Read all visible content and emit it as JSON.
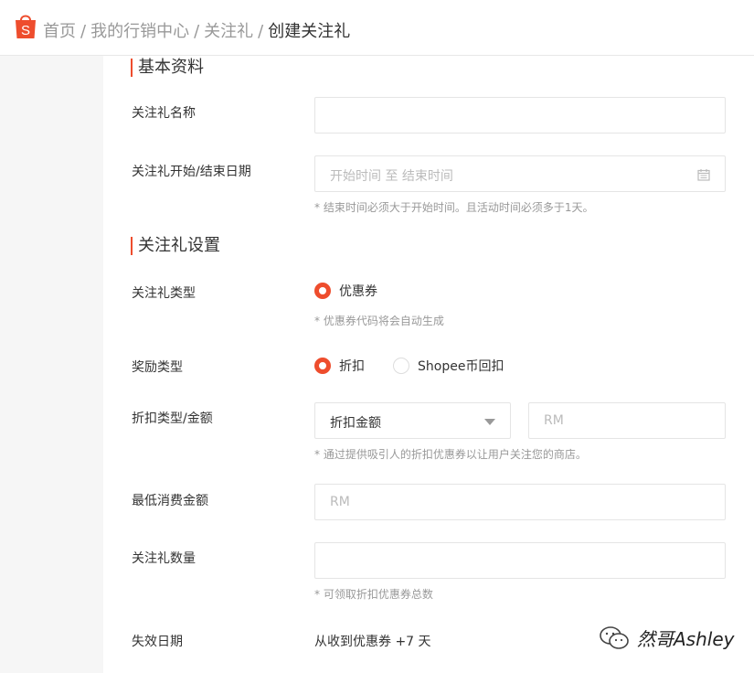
{
  "breadcrumb": {
    "items": [
      "首页",
      "我的行销中心",
      "关注礼"
    ],
    "separator": "/",
    "current": "创建关注礼"
  },
  "logo": {
    "letter": "S",
    "color": "#ee4d2d"
  },
  "sections": {
    "basic": {
      "title": "基本资料",
      "name_label": "关注礼名称",
      "name_value": "",
      "date_label": "关注礼开始/结束日期",
      "date_start_placeholder": "开始时间",
      "date_to": "至",
      "date_end_placeholder": "结束时间",
      "date_hint": "* 结束时间必须大于开始时间。且活动时间必须多于1天。"
    },
    "settings": {
      "title": "关注礼设置",
      "type_label": "关注礼类型",
      "type_option": "优惠券",
      "type_hint": "* 优惠券代码将会自动生成",
      "reward_label": "奖励类型",
      "reward_options": [
        {
          "label": "折扣",
          "selected": true
        },
        {
          "label": "Shopee币回扣",
          "selected": false
        }
      ],
      "discount_label": "折扣类型/金额",
      "discount_type_value": "折扣金额",
      "discount_amount_placeholder": "RM",
      "discount_hint": "* 通过提供吸引人的折扣优惠券以让用户关注您的商店。",
      "min_spend_label": "最低消费金额",
      "min_spend_placeholder": "RM",
      "quantity_label": "关注礼数量",
      "quantity_value": "",
      "quantity_hint": "* 可领取折扣优惠券总数",
      "expiry_label": "失效日期",
      "expiry_value": "从收到优惠券 +7 天"
    }
  },
  "watermark": {
    "text": "然哥Ashley",
    "icon": "wechat-icon"
  },
  "colors": {
    "accent": "#ee4d2d",
    "border": "#e5e5e5",
    "hint": "#999999",
    "background": "#f6f6f6"
  }
}
